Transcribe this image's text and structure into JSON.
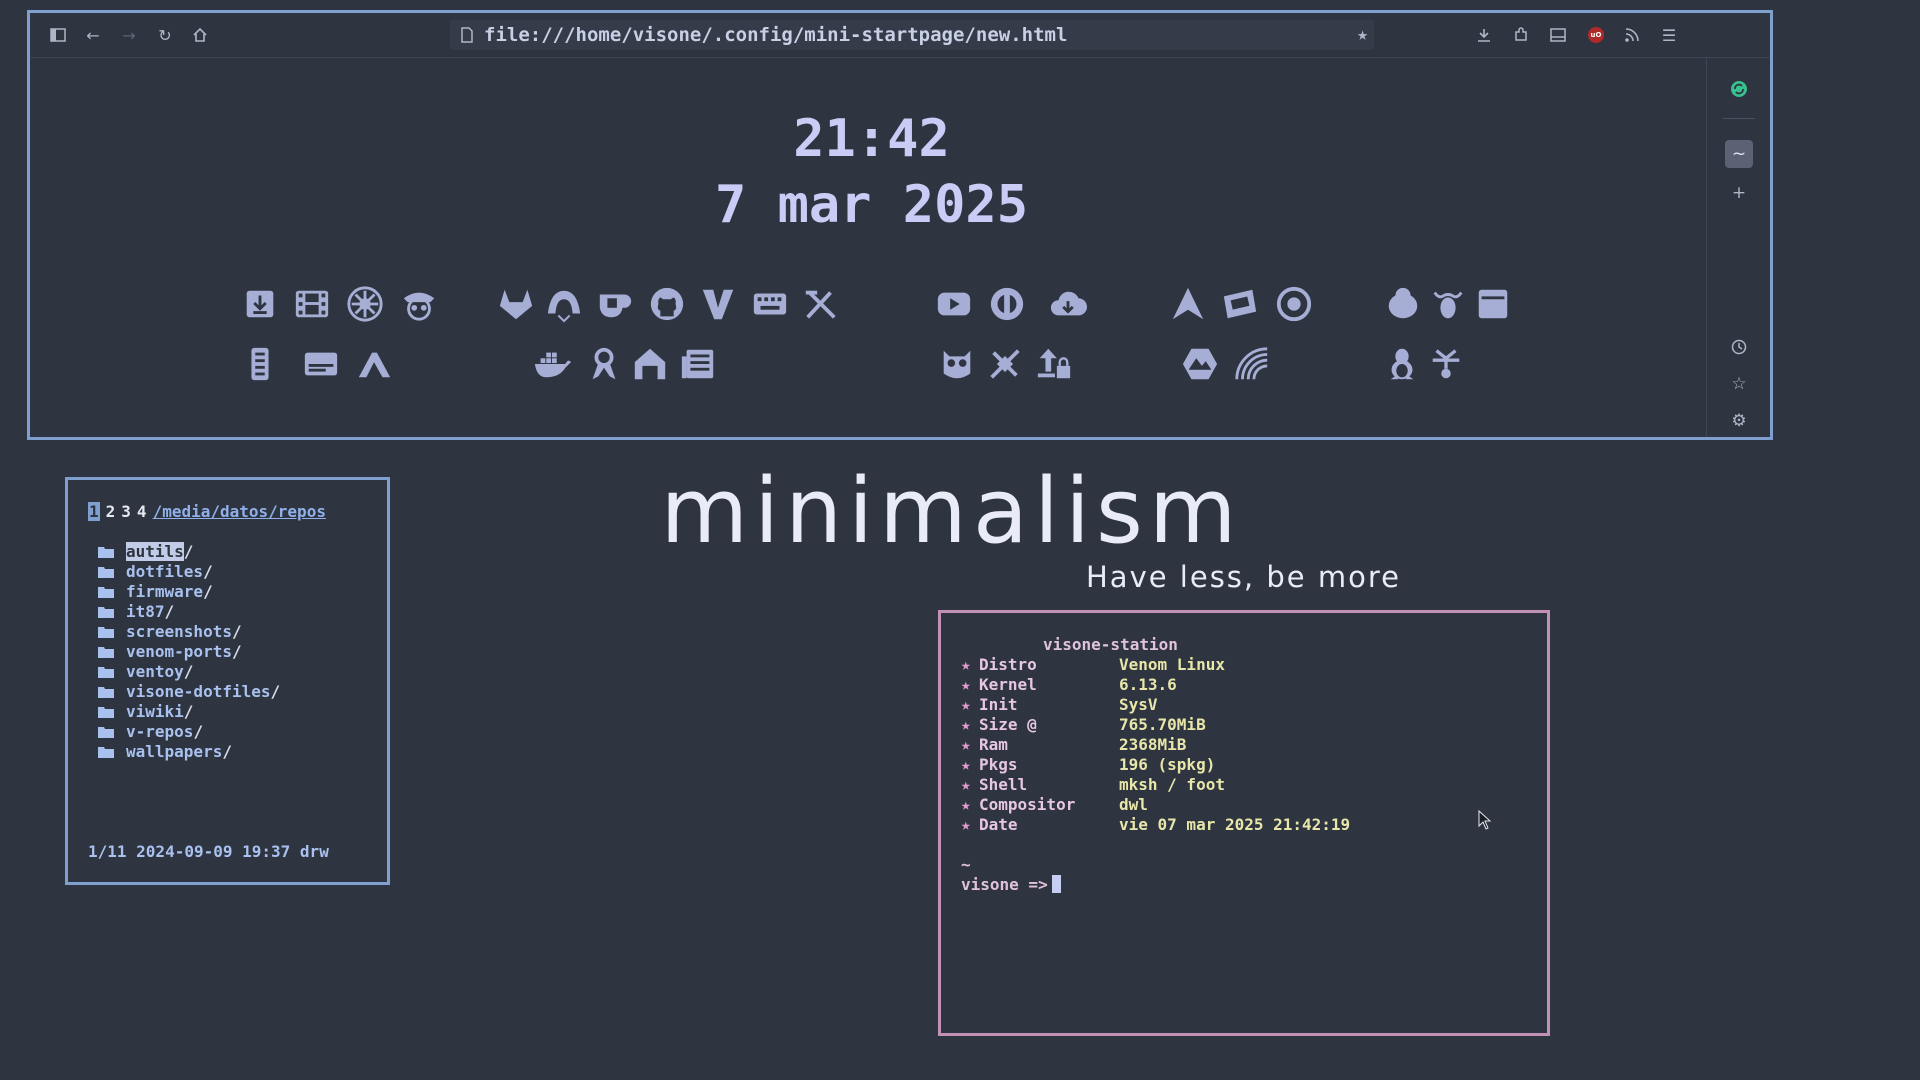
{
  "browser": {
    "url": "file:///home/visone/.config/mini-startpage/new.html",
    "ublock_label": "uO"
  },
  "startpage": {
    "time": "21:42",
    "date": "7 mar 2025"
  },
  "icons": [
    {
      "name": "download-icon"
    },
    {
      "name": "film-icon"
    },
    {
      "name": "transmission-icon"
    },
    {
      "name": "pirate-icon"
    },
    {
      "name": "gitlab-icon"
    },
    {
      "name": "gitea-icon"
    },
    {
      "name": "ko-fi-icon"
    },
    {
      "name": "github-icon"
    },
    {
      "name": "vim-icon"
    },
    {
      "name": "keyboard-icon"
    },
    {
      "name": "tools-icon"
    },
    {
      "name": "youtube-icon"
    },
    {
      "name": "wikipedia-icon"
    },
    {
      "name": "cloud-download-icon"
    },
    {
      "name": "arch-icon"
    },
    {
      "name": "ticket-icon"
    },
    {
      "name": "target-icon"
    },
    {
      "name": "penguin-icon"
    },
    {
      "name": "gnu-icon"
    },
    {
      "name": "archive-box-icon"
    },
    {
      "name": "remote-icon"
    },
    {
      "name": "subtitles-icon"
    },
    {
      "name": "brand-a-icon"
    },
    {
      "name": "docker-icon"
    },
    {
      "name": "ribbon-icon"
    },
    {
      "name": "house-icon"
    },
    {
      "name": "news-icon"
    },
    {
      "name": "owl-icon"
    },
    {
      "name": "satellite-icon"
    },
    {
      "name": "upload-lock-icon"
    },
    {
      "name": "hexagon-mountain-icon"
    },
    {
      "name": "rainbow-icon"
    },
    {
      "name": "tux-icon"
    },
    {
      "name": "fork-icon"
    }
  ],
  "filemanager": {
    "tabs": [
      "1",
      "2",
      "3",
      "4"
    ],
    "path": "/media/datos/repos",
    "entries": [
      "autils",
      "dotfiles",
      "firmware",
      "it87",
      "screenshots",
      "venom-ports",
      "ventoy",
      "visone-dotfiles",
      "viwiki",
      "v-repos",
      "wallpapers"
    ],
    "status": "1/11 2024-09-09 19:37 drw"
  },
  "hero": {
    "title": "minimalism",
    "subtitle": "Have less, be more"
  },
  "terminal": {
    "host": "visone-station",
    "info": [
      {
        "key": "Distro",
        "value": "Venom Linux"
      },
      {
        "key": "Kernel",
        "value": "6.13.6"
      },
      {
        "key": "Init",
        "value": "SysV"
      },
      {
        "key": "Size @",
        "value": "765.70MiB"
      },
      {
        "key": "Ram",
        "value": "2368MiB"
      },
      {
        "key": "Pkgs",
        "value": "196 (spkg)"
      },
      {
        "key": "Shell",
        "value": "mksh / foot"
      },
      {
        "key": "Compositor",
        "value": "dwl"
      },
      {
        "key": "Date",
        "value": "vie 07 mar 2025 21:42:19"
      }
    ],
    "tilde": "~",
    "prompt": "visone =>"
  },
  "colors": {
    "background": "#2e3440",
    "window_border": "#7fa0cf",
    "terminal_border": "#c391b6",
    "icon": "#a6aed6"
  }
}
